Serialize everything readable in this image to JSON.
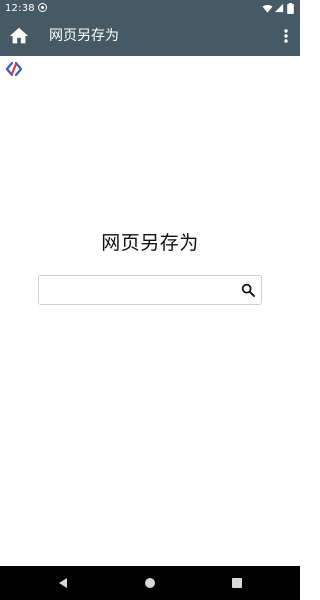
{
  "status_bar": {
    "time": "12:38",
    "icons": [
      "sync-notification-icon",
      "wifi-icon",
      "signal-icon",
      "battery-icon"
    ]
  },
  "app_bar": {
    "title": "网页另存为",
    "home_icon": "home-icon",
    "menu_icon": "more-vert-icon",
    "color": "#455a64"
  },
  "main": {
    "heading": "网页另存为",
    "search": {
      "value": "",
      "placeholder": "",
      "icon": "search-icon"
    }
  },
  "nav_bar": {
    "icons": [
      "back-icon",
      "home-circle-icon",
      "recents-icon"
    ]
  },
  "colors": {
    "accent": "#455a64",
    "logo_blue": "#2f5fd0",
    "logo_red": "#e0383c"
  }
}
